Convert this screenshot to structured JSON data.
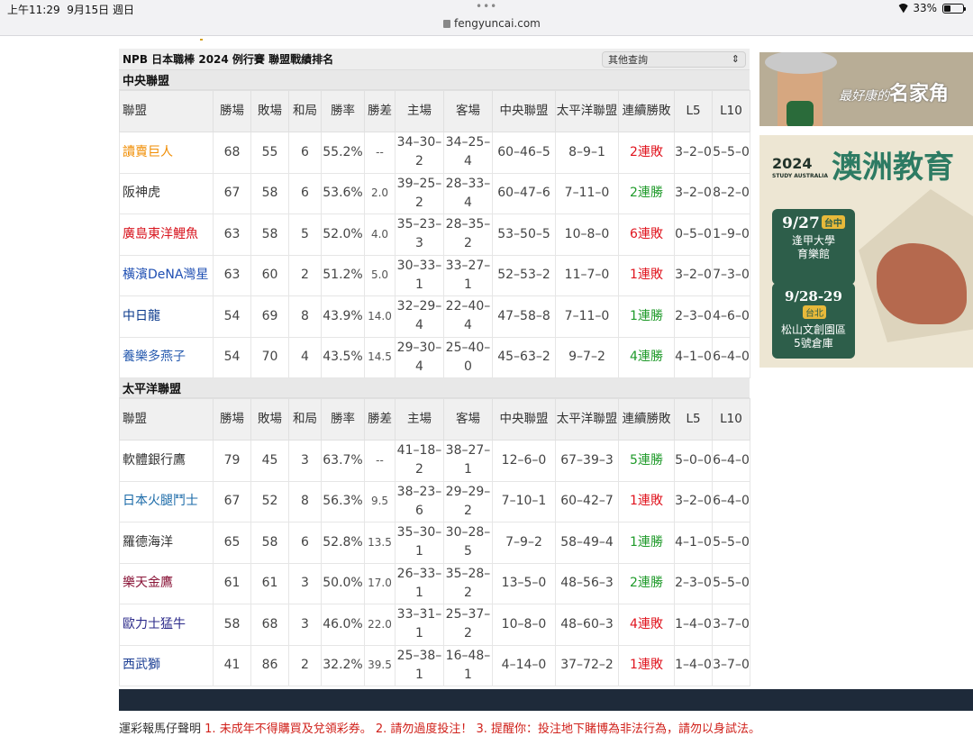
{
  "status": {
    "time": "上午11:29",
    "date": "9月15日 週日",
    "dots": "•••",
    "url": "fengyuncai.com",
    "battery": "33%",
    "battery_level": 0.33
  },
  "page": {
    "title": "NPB 日本職棒 2024 例行賽 聯盟戰績排名",
    "query_label": "其他查詢"
  },
  "columns": [
    "聯盟",
    "勝場",
    "敗場",
    "和局",
    "勝率",
    "勝差",
    "主場",
    "客場",
    "中央聯盟",
    "太平洋聯盟",
    "連續勝敗",
    "L5",
    "L10"
  ],
  "leagues": [
    {
      "name": "中央聯盟",
      "teams": [
        {
          "team": "讀賣巨人",
          "color": "#f08c00",
          "w": "68",
          "l": "55",
          "t": "6",
          "pct": "55.2%",
          "gb": "--",
          "home": "34–30–2",
          "away": "34–25–4",
          "cl": "60–46–5",
          "pl": "8–9–1",
          "streak": "2連敗",
          "win": false,
          "l5": "3–2–0",
          "l10": "5–5–0"
        },
        {
          "team": "阪神虎",
          "color": "#333333",
          "w": "67",
          "l": "58",
          "t": "6",
          "pct": "53.6%",
          "gb": "2.0",
          "home": "39–25–2",
          "away": "28–33–4",
          "cl": "60–47–6",
          "pl": "7–11–0",
          "streak": "2連勝",
          "win": true,
          "l5": "3–2–0",
          "l10": "8–2–0"
        },
        {
          "team": "廣島東洋鯉魚",
          "color": "#d8141e",
          "w": "63",
          "l": "58",
          "t": "5",
          "pct": "52.0%",
          "gb": "4.0",
          "home": "35–23–3",
          "away": "28–35–2",
          "cl": "53–50–5",
          "pl": "10–8–0",
          "streak": "6連敗",
          "win": false,
          "l5": "0–5–0",
          "l10": "1–9–0"
        },
        {
          "team": "橫濱DeNA灣星",
          "color": "#1f4fb3",
          "w": "63",
          "l": "60",
          "t": "2",
          "pct": "51.2%",
          "gb": "5.0",
          "home": "30–33–1",
          "away": "33–27–1",
          "cl": "52–53–2",
          "pl": "11–7–0",
          "streak": "1連敗",
          "win": false,
          "l5": "3–2–0",
          "l10": "7–3–0"
        },
        {
          "team": "中日龍",
          "color": "#0b3a8c",
          "w": "54",
          "l": "69",
          "t": "8",
          "pct": "43.9%",
          "gb": "14.0",
          "home": "32–29–4",
          "away": "22–40–4",
          "cl": "47–58–8",
          "pl": "7–11–0",
          "streak": "1連勝",
          "win": true,
          "l5": "2–3–0",
          "l10": "4–6–0"
        },
        {
          "team": "養樂多燕子",
          "color": "#2a5db0",
          "w": "54",
          "l": "70",
          "t": "4",
          "pct": "43.5%",
          "gb": "14.5",
          "home": "29–30–4",
          "away": "25–40–0",
          "cl": "45–63–2",
          "pl": "9–7–2",
          "streak": "4連勝",
          "win": true,
          "l5": "4–1–0",
          "l10": "6–4–0"
        }
      ]
    },
    {
      "name": "太平洋聯盟",
      "teams": [
        {
          "team": "軟體銀行鷹",
          "color": "#333333",
          "w": "79",
          "l": "45",
          "t": "3",
          "pct": "63.7%",
          "gb": "--",
          "home": "41–18–2",
          "away": "38–27–1",
          "cl": "12–6–0",
          "pl": "67–39–3",
          "streak": "5連勝",
          "win": true,
          "l5": "5–0–0",
          "l10": "6–4–0"
        },
        {
          "team": "日本火腿鬥士",
          "color": "#1a6aa8",
          "w": "67",
          "l": "52",
          "t": "8",
          "pct": "56.3%",
          "gb": "9.5",
          "home": "38–23–6",
          "away": "29–29–2",
          "cl": "7–10–1",
          "pl": "60–42–7",
          "streak": "1連敗",
          "win": false,
          "l5": "3–2–0",
          "l10": "6–4–0"
        },
        {
          "team": "羅德海洋",
          "color": "#333333",
          "w": "65",
          "l": "58",
          "t": "6",
          "pct": "52.8%",
          "gb": "13.5",
          "home": "35–30–1",
          "away": "30–28–5",
          "cl": "7–9–2",
          "pl": "58–49–4",
          "streak": "1連勝",
          "win": true,
          "l5": "4–1–0",
          "l10": "5–5–0"
        },
        {
          "team": "樂天金鷹",
          "color": "#8a1538",
          "w": "61",
          "l": "61",
          "t": "3",
          "pct": "50.0%",
          "gb": "17.0",
          "home": "26–33–1",
          "away": "35–28–2",
          "cl": "13–5–0",
          "pl": "48–56–3",
          "streak": "2連勝",
          "win": true,
          "l5": "2–3–0",
          "l10": "5–5–0"
        },
        {
          "team": "歐力士猛牛",
          "color": "#2b2a8a",
          "w": "58",
          "l": "68",
          "t": "3",
          "pct": "46.0%",
          "gb": "22.0",
          "home": "33–31–1",
          "away": "25–37–2",
          "cl": "10–8–0",
          "pl": "48–60–3",
          "streak": "4連敗",
          "win": false,
          "l5": "1–4–0",
          "l10": "3–7–0"
        },
        {
          "team": "西武獅",
          "color": "#1c3f94",
          "w": "41",
          "l": "86",
          "t": "2",
          "pct": "32.2%",
          "gb": "39.5",
          "home": "25–38–1",
          "away": "16–48–1",
          "cl": "4–14–0",
          "pl": "37–72–2",
          "streak": "1連敗",
          "win": false,
          "l5": "1–4–0",
          "l10": "3–7–0"
        }
      ]
    }
  ],
  "ads": {
    "ad1": {
      "small": "最好康的",
      "big": "名家角"
    },
    "ad2": {
      "year": "2024",
      "brand": "STUDY AUSTRALIA",
      "heading": "澳洲教育",
      "events": [
        {
          "date": "9/27",
          "city": "台中",
          "venue_line1": "逢甲大學",
          "venue_line2": "育樂館"
        },
        {
          "date": "9/28-29",
          "city": "台北",
          "venue_line1": "松山文創園區",
          "venue_line2": "5號倉庫"
        }
      ]
    }
  },
  "disclaimer": {
    "prefix": "運彩報馬仔聲明",
    "text": "1. 未成年不得購買及兌領彩券。 2. 請勿過度投注！ 3. 提醒你：投注地下賭博為非法行為，請勿以身試法。"
  },
  "colors": {
    "win": "#1f9a2a",
    "lose": "#e0141e",
    "footer": "#1e2a3a"
  }
}
